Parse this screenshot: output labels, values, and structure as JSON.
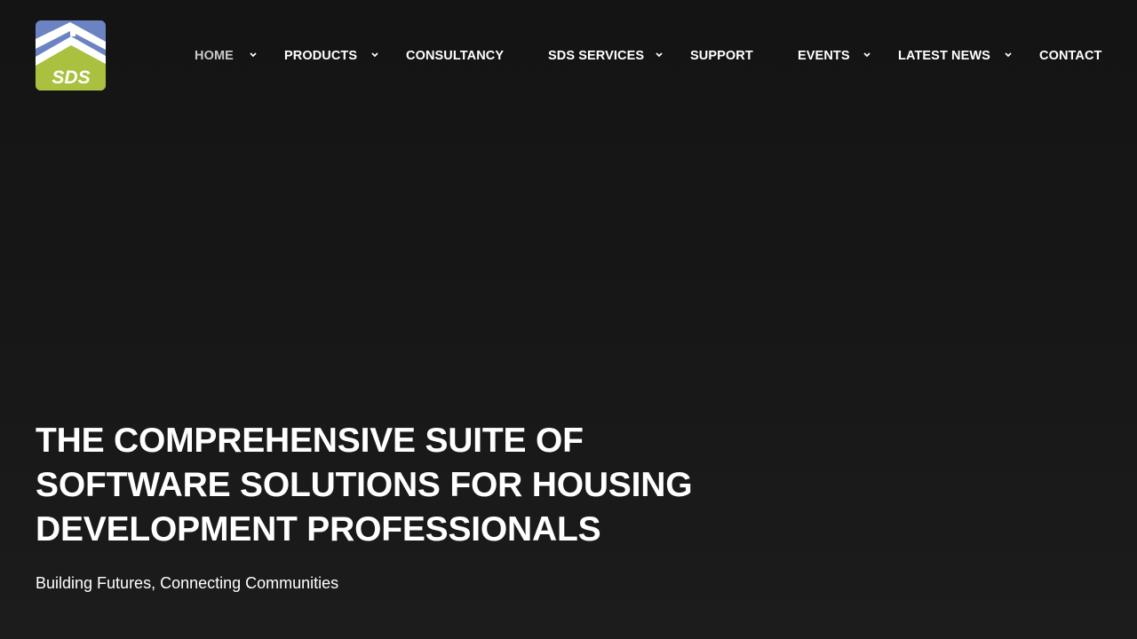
{
  "brand": {
    "logo_text": "SDS",
    "colors": {
      "blue": "#6c83c2",
      "green": "#a9c13e",
      "white": "#ffffff"
    }
  },
  "nav": {
    "home": "HOME",
    "products": "PRODUCTS",
    "consultancy": "CONSULTANCY",
    "sds_services": "SDS SERVICES",
    "support": "SUPPORT",
    "events": "EVENTS",
    "latest_news": "LATEST NEWS",
    "contact": "CONTACT",
    "active": "HOME"
  },
  "hero": {
    "title_lines": [
      "THE COMPREHENSIVE SUITE OF",
      "SOFTWARE SOLUTIONS FOR HOUSING",
      "DEVELOPMENT PROFESSIONALS"
    ],
    "tagline": "Building Futures, Connecting Communities"
  }
}
